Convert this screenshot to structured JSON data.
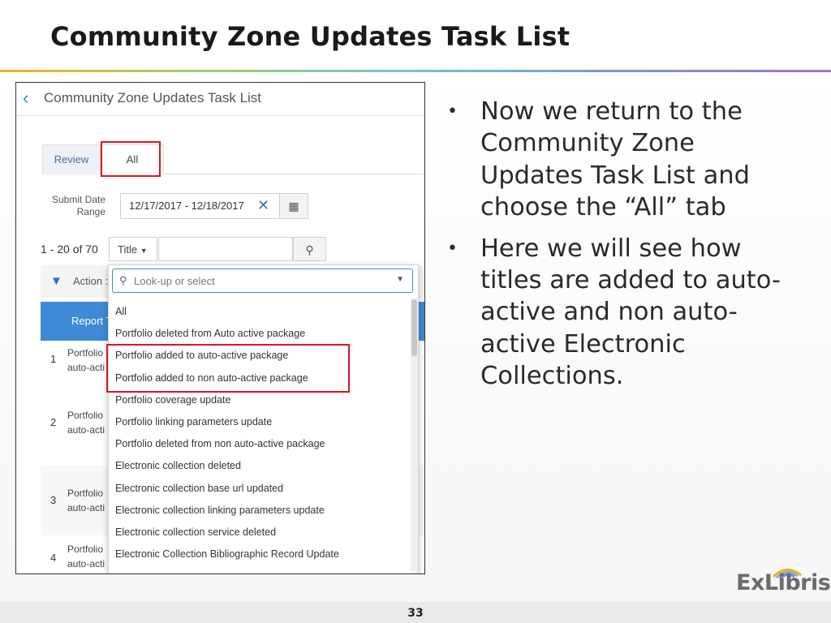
{
  "slide": {
    "title": "Community Zone Updates Task List",
    "page_number": "33",
    "logo_text": "ExLibris",
    "bullets": [
      "Now we return to the Community Zone Updates Task List and choose the “All” tab",
      "Here we will see how titles are added to auto-active and non auto-active Electronic Collections."
    ]
  },
  "screenshot": {
    "header_title": "Community Zone Updates Task List",
    "tabs": [
      {
        "label": "Review"
      },
      {
        "label": "All"
      }
    ],
    "date_range_label": "Submit Date Range",
    "date_range_value": "12/17/2017 - 12/18/2017",
    "results_count": "1 - 20 of 70",
    "search_field_selector": "Title",
    "filter_label": "Action :",
    "table_header": "Report T",
    "rows": [
      {
        "num": "1",
        "text": "Portfolio auto-acti"
      },
      {
        "num": "2",
        "text": "Portfolio auto-acti"
      },
      {
        "num": "3",
        "text": "Portfolio auto-acti"
      },
      {
        "num": "4",
        "text": "Portfolio auto-acti"
      }
    ],
    "dropdown": {
      "placeholder": "Look-up or select",
      "options": [
        "All",
        "Portfolio deleted from Auto active package",
        "Portfolio added to auto-active package",
        "Portfolio added to non auto-active package",
        "Portfolio coverage update",
        "Portfolio linking parameters update",
        "Portfolio deleted from non auto-active package",
        "Electronic collection deleted",
        "Electronic collection base url updated",
        "Electronic collection linking parameters update",
        "Electronic collection service deleted",
        "Electronic Collection Bibliographic Record Update"
      ]
    }
  },
  "colors": {
    "highlight": "#e0141e",
    "accent_blue": "#3e8ad6",
    "title_text": "#1a1a1a"
  }
}
